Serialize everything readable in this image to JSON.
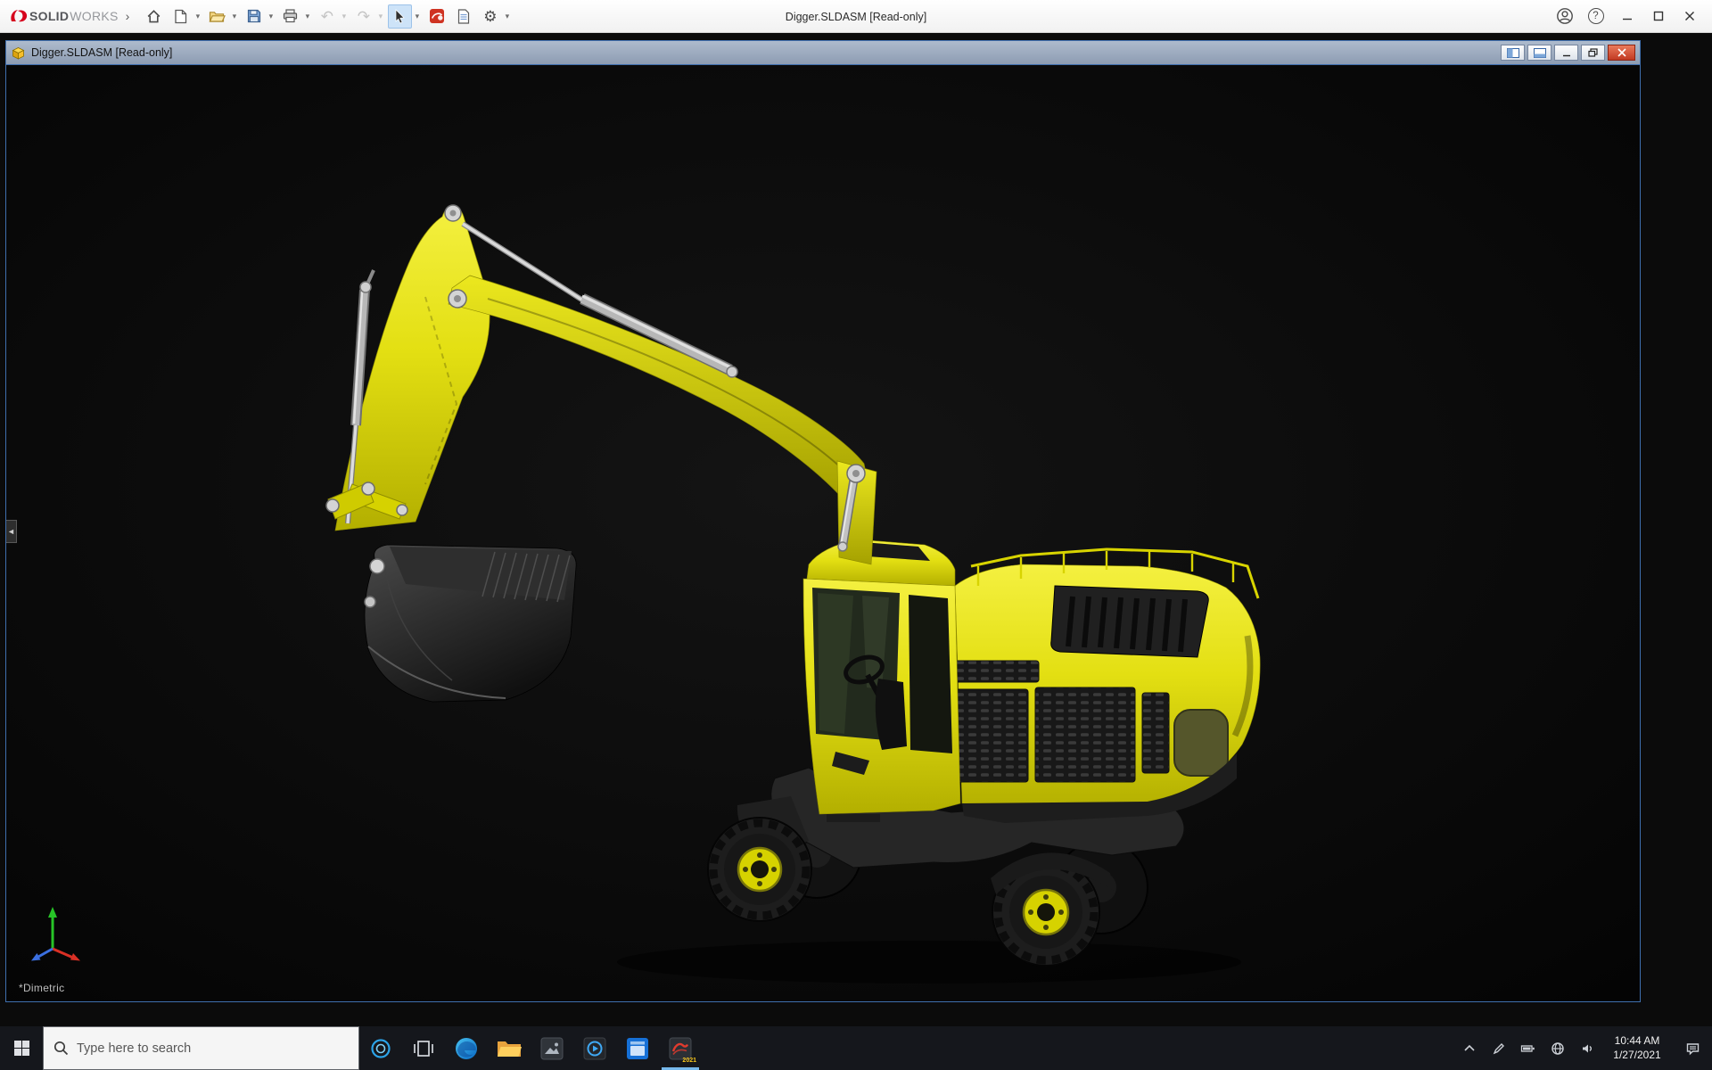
{
  "app": {
    "brand": {
      "solid": "SOLID",
      "works": "WORKS"
    },
    "title": "Digger.SLDASM [Read-only]"
  },
  "glyphs": {
    "expander": "›",
    "dropdown": "▾",
    "undo": "↶",
    "redo": "↷",
    "gear": "⚙",
    "help": "?",
    "flyout": "◄"
  },
  "doc_window": {
    "title": "Digger.SLDASM [Read-only]"
  },
  "viewport": {
    "view_orientation": "*Dimetric"
  },
  "taskbar": {
    "search_placeholder": "Type here to search",
    "time": "10:44 AM",
    "date": "1/27/2021",
    "solidworks_badge": "2021"
  },
  "colors": {
    "excavator_yellow": "#e3df12",
    "viewport_bg": "#0a0a0a",
    "doc_titlebar_blue": "#97a6bb",
    "taskbar_bg": "#15171c",
    "window_border_blue": "#3f6fae",
    "close_button_red": "#cf4a35"
  }
}
